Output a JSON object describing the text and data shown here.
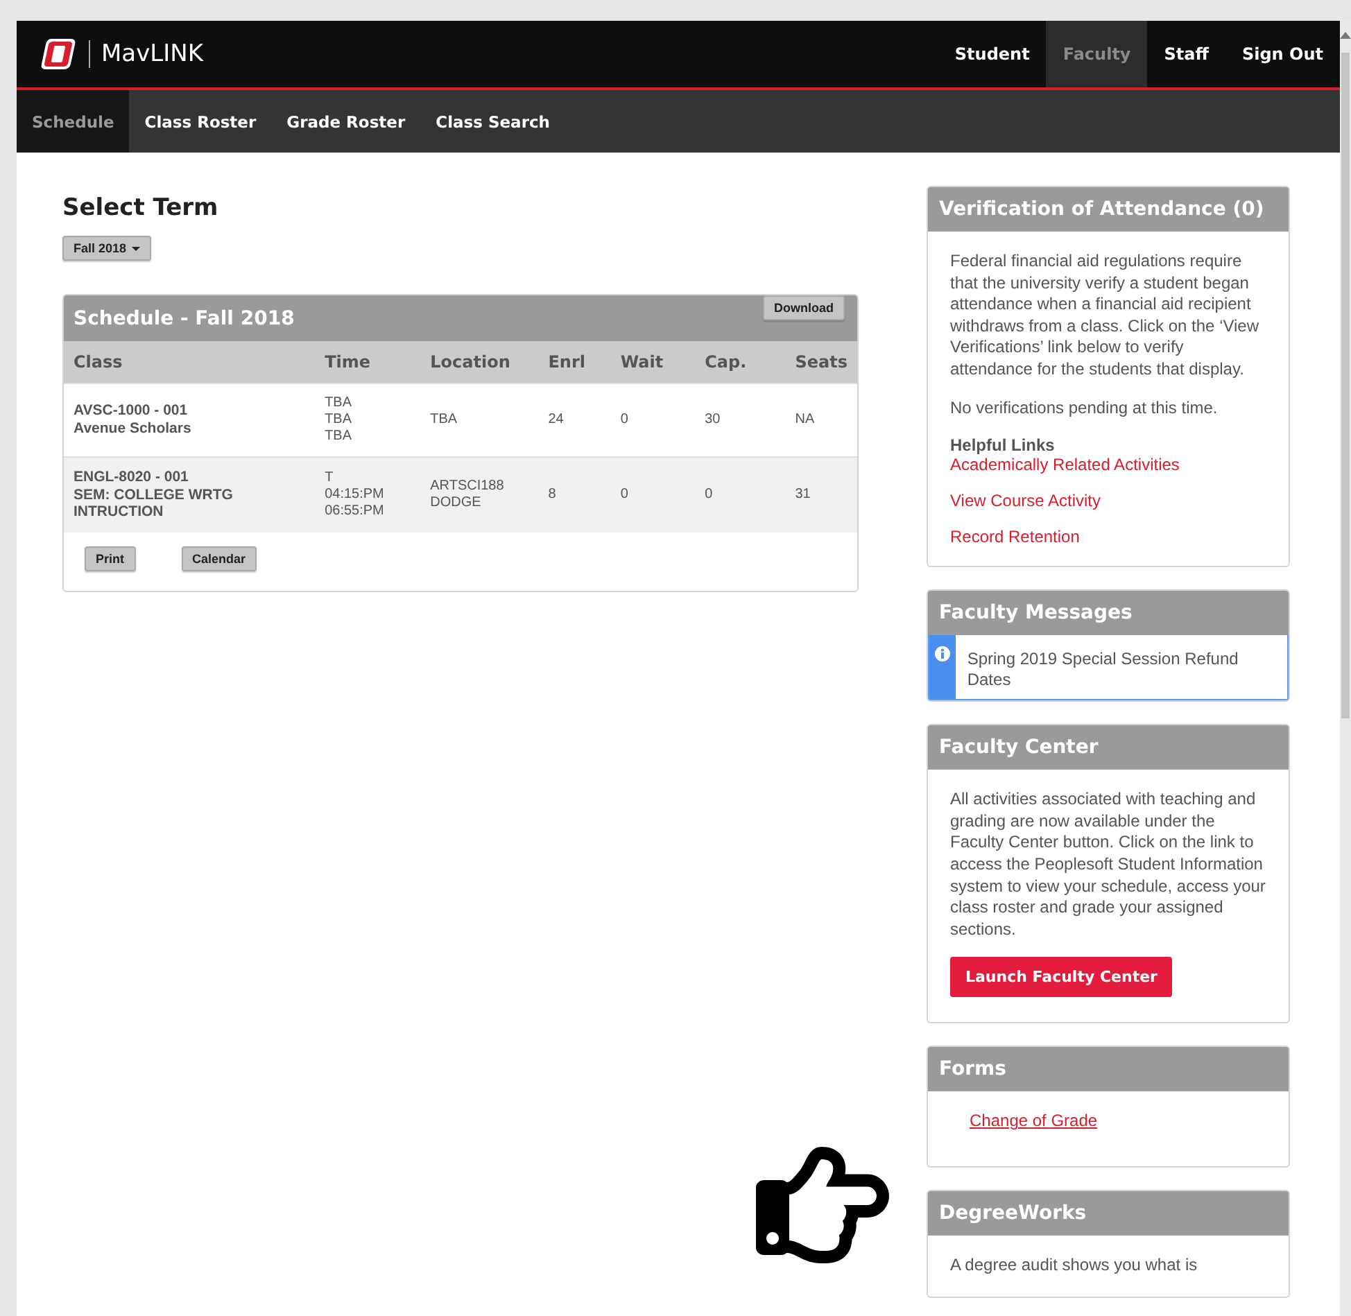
{
  "brand": {
    "name": "MavLINK"
  },
  "top_nav": [
    {
      "label": "Student",
      "selected": false
    },
    {
      "label": "Faculty",
      "selected": true
    },
    {
      "label": "Staff",
      "selected": false
    },
    {
      "label": "Sign Out",
      "selected": false
    }
  ],
  "sub_nav": [
    {
      "label": "Schedule",
      "selected": true
    },
    {
      "label": "Class Roster",
      "selected": false
    },
    {
      "label": "Grade Roster",
      "selected": false
    },
    {
      "label": "Class Search",
      "selected": false
    }
  ],
  "term": {
    "heading": "Select Term",
    "value": "Fall 2018"
  },
  "schedule": {
    "title": "Schedule - Fall 2018",
    "download": "Download",
    "columns": [
      "Class",
      "Time",
      "Location",
      "Enrl",
      "Wait",
      "Cap.",
      "Seats"
    ],
    "rows": [
      {
        "class_code": "AVSC-1000 - 001",
        "class_title": "Avenue Scholars",
        "time": [
          "TBA",
          "TBA",
          "TBA"
        ],
        "location": [
          "TBA"
        ],
        "enrl": "24",
        "wait": "0",
        "cap": "30",
        "seats": "NA"
      },
      {
        "class_code": "ENGL-8020 - 001",
        "class_title": "SEM: COLLEGE WRTG INTRUCTION",
        "time": [
          "T",
          "04:15:PM",
          "06:55:PM"
        ],
        "location": [
          "ARTSCI188",
          "DODGE"
        ],
        "enrl": "8",
        "wait": "0",
        "cap": "0",
        "seats": "31"
      }
    ],
    "buttons": [
      "Print",
      "Calendar"
    ]
  },
  "panels": [
    {
      "title": "Verification of Attendance (0)",
      "blocks": [
        {
          "kind": "paragraph",
          "text": "Federal financial aid regulations require that the university verify a student began attendance when a financial aid recipient withdraws from a class. Click on the ‘View Verifications’ link below to verify attendance for the students that display."
        },
        {
          "kind": "paragraph",
          "text": "No verifications pending at this time."
        },
        {
          "kind": "heading",
          "text": "Helpful Links"
        },
        {
          "kind": "link",
          "text": "Academically Related Activities"
        },
        {
          "kind": "link",
          "text": "View Course Activity"
        },
        {
          "kind": "link",
          "text": "Record Retention"
        }
      ]
    },
    {
      "title": "Faculty Messages",
      "blocks": [
        {
          "kind": "message",
          "text": "Spring 2019 Special Session Refund Dates"
        }
      ]
    },
    {
      "title": "Faculty Center",
      "blocks": [
        {
          "kind": "paragraph",
          "text": "All activities associated with teaching and grading are now available under the Faculty Center button. Click on the link to access the Peoplesoft Student Information system to view your schedule, access your class roster and grade your assigned sections."
        },
        {
          "kind": "button",
          "text": "Launch Faculty Center"
        }
      ]
    },
    {
      "title": "Forms",
      "blocks": [
        {
          "kind": "form_link",
          "text": "Change of Grade"
        }
      ]
    },
    {
      "title": "DegreeWorks",
      "blocks": [
        {
          "kind": "paragraph",
          "text": "A degree audit shows you what is"
        }
      ]
    }
  ]
}
